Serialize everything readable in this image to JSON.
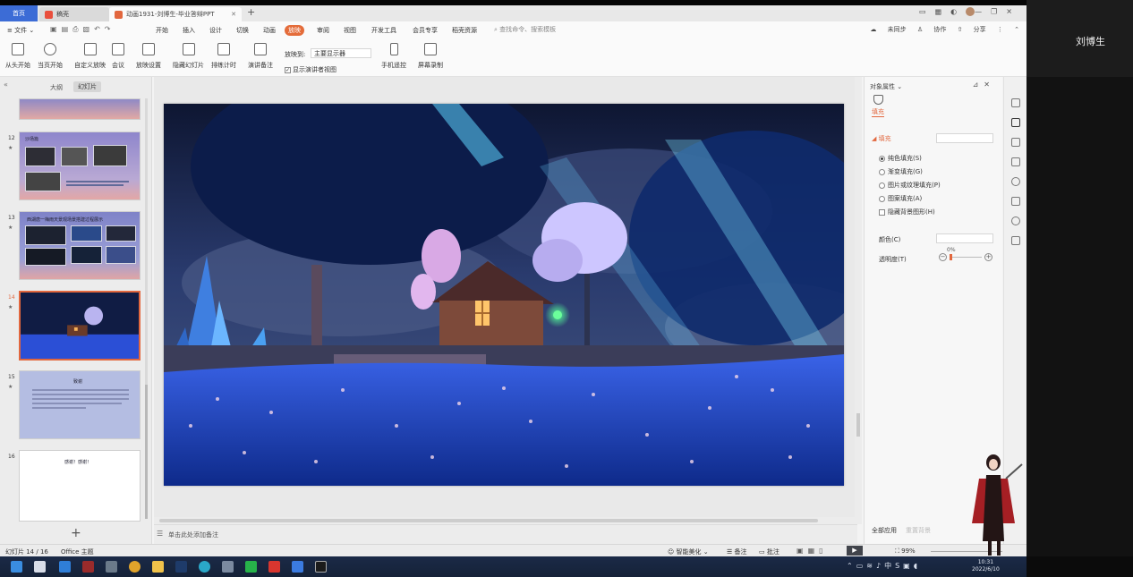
{
  "tabs": {
    "home": "首页",
    "doc1": "稿壳",
    "doc2": "动画1931-刘博生-毕业答辩PPT"
  },
  "menu": [
    "开始",
    "插入",
    "设计",
    "切换",
    "动画",
    "放映",
    "审阅",
    "视图",
    "开发工具",
    "会员专享",
    "稻壳资源"
  ],
  "menu_active_index": 5,
  "file_menu": "文件",
  "search_placeholder": "查找命令、搜索模板",
  "right_menu": [
    "未同步",
    "协作",
    "分享"
  ],
  "toolbar": [
    "从头开始",
    "当页开始",
    "自定义放映",
    "会议",
    "放映设置",
    "隐藏幻灯片",
    "排练计时",
    "演讲备注",
    "手机遥控",
    "屏幕录制"
  ],
  "slide_to_label": "放映到:",
  "slide_to_value": "主要显示器",
  "show_presenter_label": "显示演讲者视图",
  "left_panel": {
    "outline": "大纲",
    "slides": "幻灯片",
    "numbers": [
      "12",
      "13",
      "14",
      "15",
      "16"
    ],
    "t12_title": "沙场篇",
    "t13_title": "西湖唐一梅雨天景观场景搭建过程展示",
    "t15_title": "致谢",
    "t16_title": "感谢！感谢！"
  },
  "notes_placeholder": "单击此处添加备注",
  "props": {
    "title": "对象属性",
    "tab_fill": "填充",
    "fill_head": "填充",
    "options": [
      "纯色填充(S)",
      "渐变填充(G)",
      "图片或纹理填充(P)",
      "图案填充(A)"
    ],
    "hide_bg": "隐藏背景图形(H)",
    "color_label": "颜色(C)",
    "trans_label": "透明度(T)",
    "trans_value": "0%",
    "transparency": 0,
    "apply_all": "全部应用",
    "reset_bg": "重置背景"
  },
  "status": {
    "slide": "幻灯片 14 / 16",
    "theme": "Office 主题",
    "beautify": "智能美化",
    "notes": "备注",
    "comment": "批注",
    "zoom": "99%"
  },
  "clock": {
    "time": "10:31",
    "date": "2022/6/10"
  },
  "tray_ime": "中",
  "user_name": "刘博生",
  "colors": {
    "accent": "#e2673e",
    "home_tab": "#3c6cd6",
    "taskbar": "#1b2a47"
  }
}
